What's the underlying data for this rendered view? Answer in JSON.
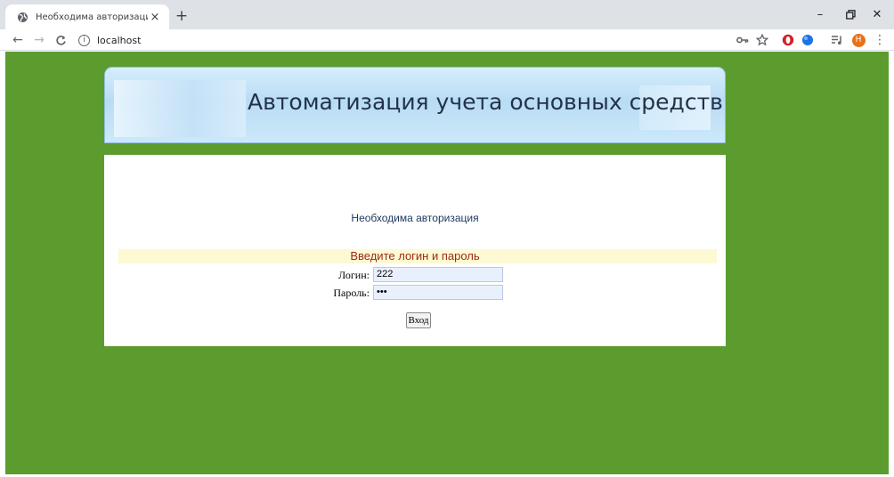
{
  "browser": {
    "tab_title": "Необходима авторизация",
    "tab_close": "×",
    "new_tab": "+",
    "url": "localhost",
    "info_glyph": "i",
    "nav": {
      "back": "←",
      "forward": "→",
      "reload": "C"
    },
    "window": {
      "minimize": "–",
      "restore": "❐",
      "close": "✕"
    },
    "profile_initial": "Н",
    "menu": "⋮"
  },
  "page": {
    "banner_title": "Автоматизация учета основных средств",
    "auth_message": "Необходима авторизация",
    "hint": "Введите логин и пароль",
    "login_label": "Логин:",
    "login_value": "222",
    "password_label": "Пароль:",
    "password_value": "•••",
    "submit_label": "Вход"
  },
  "colors": {
    "page_background": "#5c9c2f",
    "banner_text": "#23324a",
    "hint_text": "#9b2a1a",
    "hint_background": "#fdf9d3",
    "input_background": "#e8f0fe"
  }
}
